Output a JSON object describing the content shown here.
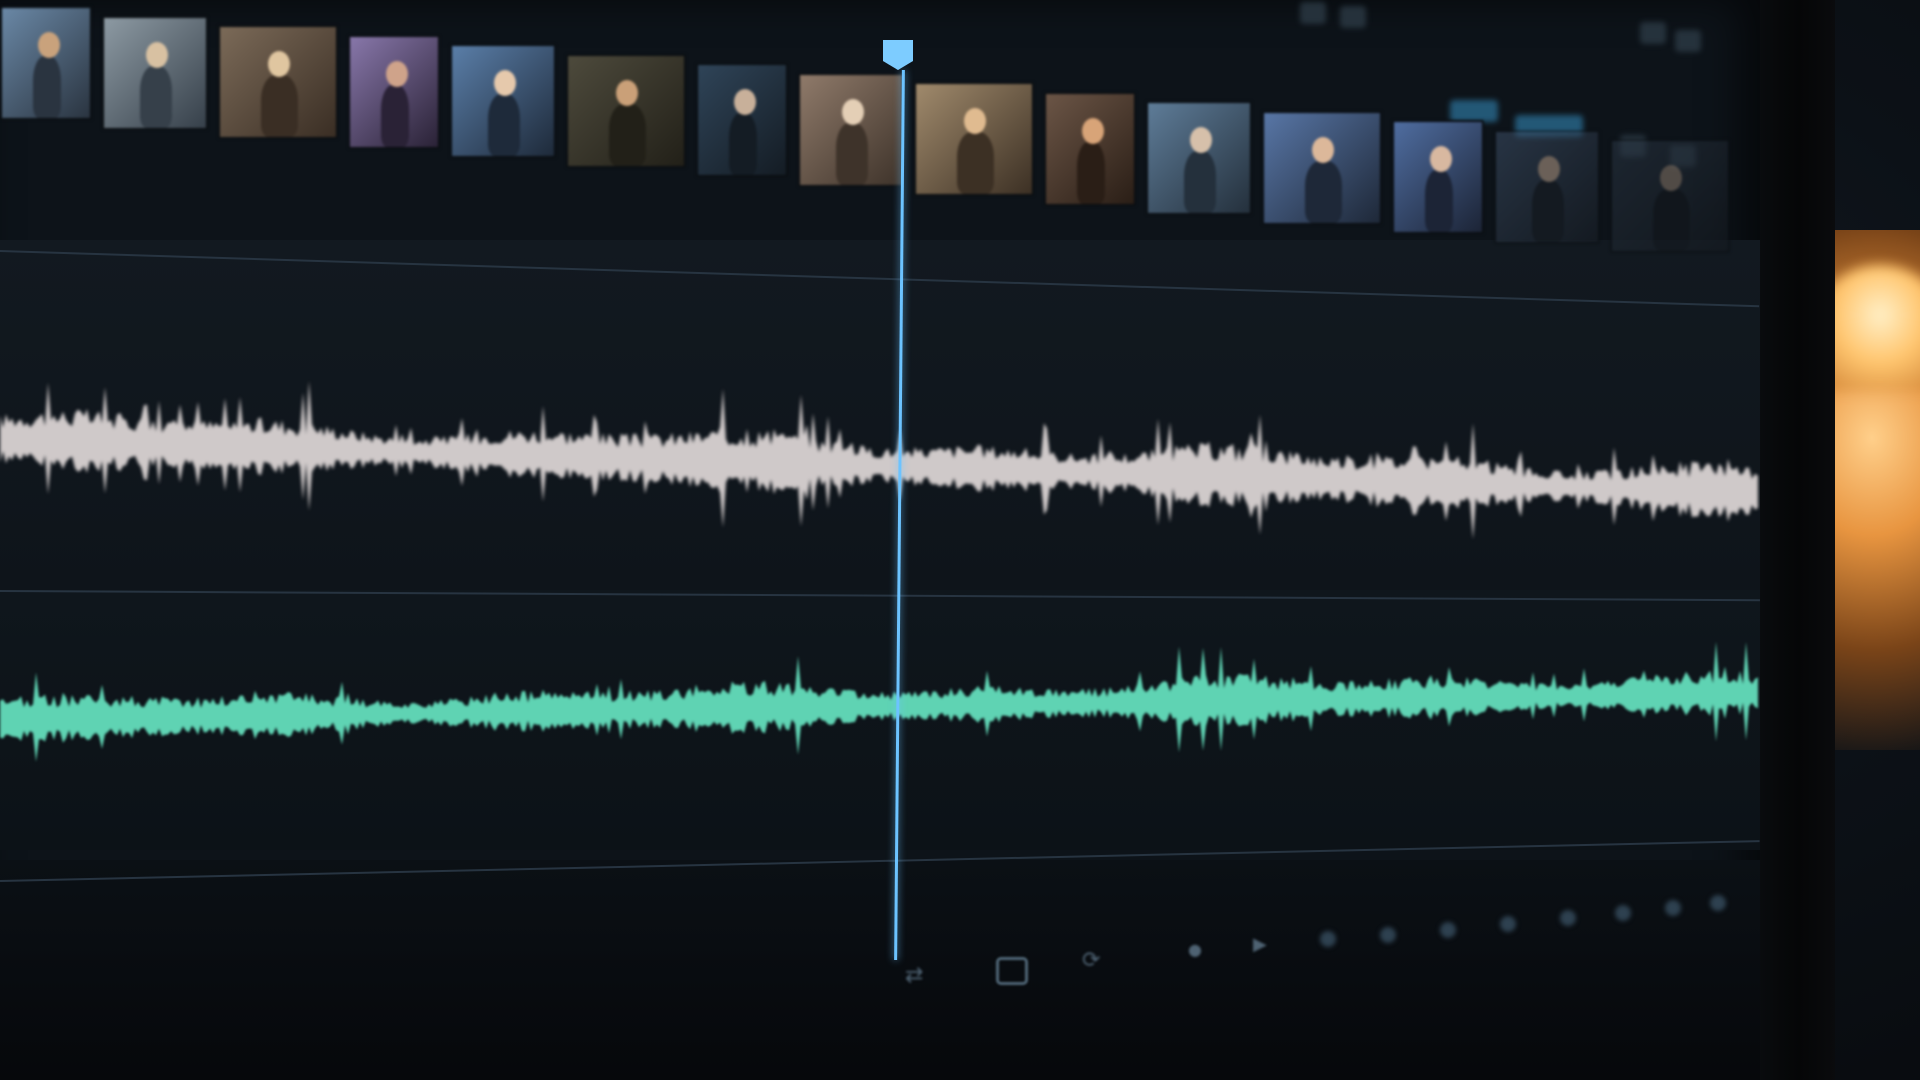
{
  "app": {
    "type": "video-editor-timeline"
  },
  "colors": {
    "playhead": "#6cc3ff",
    "waveform_primary": "#cfc9c9",
    "waveform_secondary": "#5fd3b3",
    "background": "#0d1319",
    "ambient_light": "#ffb45a"
  },
  "timeline": {
    "thumbnails_count": 15,
    "tracks": [
      {
        "name": "",
        "kind": "video-thumbnails"
      },
      {
        "name": "",
        "kind": "audio-waveform-white"
      },
      {
        "name": "",
        "kind": "audio-waveform-teal"
      }
    ]
  },
  "icons": {
    "transport": [
      "swap-icon",
      "screen-icon",
      "loop-icon",
      "marker-icon",
      "play-icon"
    ],
    "header": [
      "toolbar-icon",
      "toolbar-icon",
      "toolbar-icon"
    ]
  }
}
